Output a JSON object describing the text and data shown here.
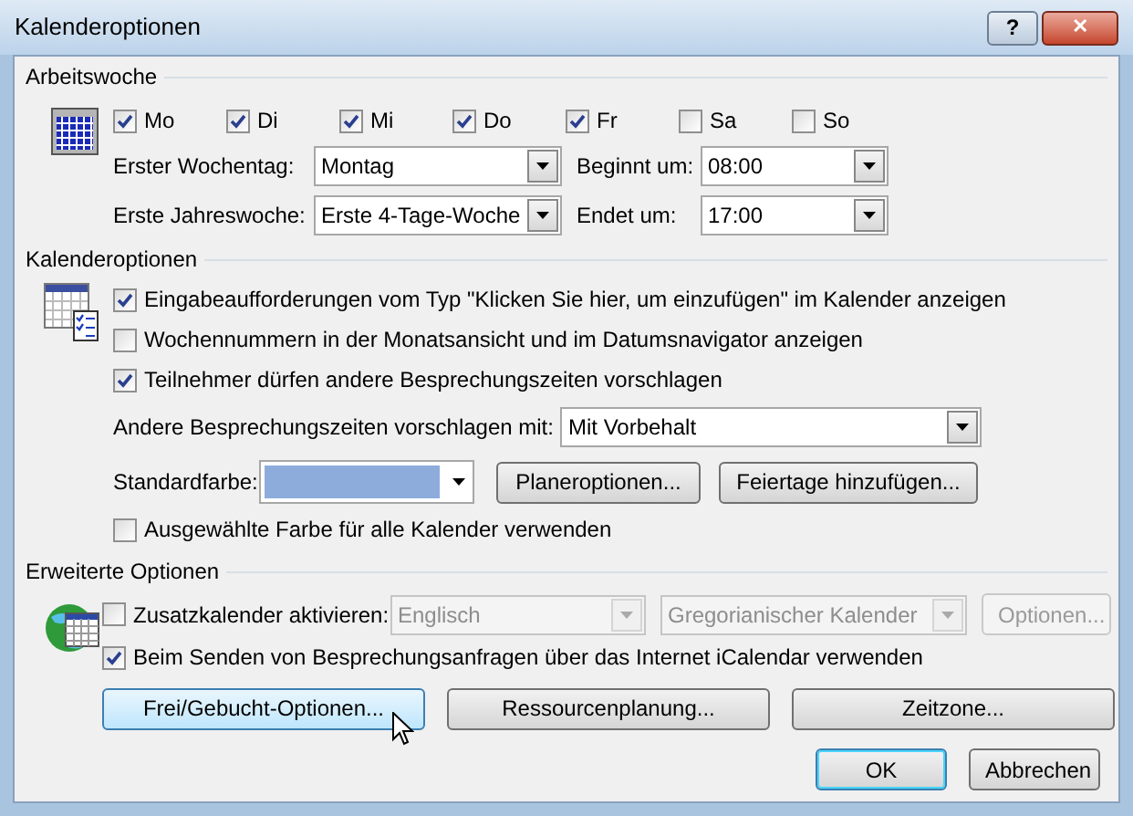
{
  "window": {
    "title": "Kalenderoptionen",
    "help_button": "?",
    "close_button": "✕"
  },
  "work_week": {
    "heading": "Arbeitswoche",
    "days": [
      {
        "label": "Mo",
        "checked": true
      },
      {
        "label": "Di",
        "checked": true
      },
      {
        "label": "Mi",
        "checked": true
      },
      {
        "label": "Do",
        "checked": true
      },
      {
        "label": "Fr",
        "checked": true
      },
      {
        "label": "Sa",
        "checked": false
      },
      {
        "label": "So",
        "checked": false
      }
    ],
    "first_day": {
      "label": "Erster Wochentag:",
      "value": "Montag"
    },
    "first_week": {
      "label": "Erste Jahreswoche:",
      "value": "Erste 4-Tage-Woche"
    },
    "start": {
      "label": "Beginnt um:",
      "value": "08:00"
    },
    "end": {
      "label": "Endet um:",
      "value": "17:00"
    }
  },
  "calendar_options": {
    "heading": "Kalenderoptionen",
    "checks": [
      {
        "label": "Eingabeaufforderungen vom Typ \"Klicken Sie hier, um einzufügen\" im Kalender anzeigen",
        "checked": true
      },
      {
        "label": "Wochennummern in der Monatsansicht und im Datumsnavigator anzeigen",
        "checked": false
      },
      {
        "label": "Teilnehmer dürfen andere Besprechungszeiten vorschlagen",
        "checked": true
      }
    ],
    "propose": {
      "label": "Andere Besprechungszeiten vorschlagen mit:",
      "value": "Mit Vorbehalt"
    },
    "default_color": {
      "label": "Standardfarbe:",
      "color": "#8eacdb"
    },
    "buttons": [
      {
        "label": "Planeroptionen..."
      },
      {
        "label": "Feiertage hinzufügen..."
      }
    ],
    "all_calendars": {
      "label": "Ausgewählte Farbe für alle Kalender verwenden",
      "checked": false
    }
  },
  "advanced": {
    "heading": "Erweiterte Optionen",
    "additional": {
      "label": "Zusatzkalender aktivieren:",
      "checked": false,
      "language": "Englisch",
      "calendar": "Gregorianischer Kalender",
      "options_button": "Optionen...",
      "disabled": true
    },
    "icalendar": {
      "label": "Beim Senden von Besprechungsanfragen über das Internet iCalendar verwenden",
      "checked": true
    },
    "buttons": [
      {
        "label": "Frei/Gebucht-Optionen...",
        "hovered": true
      },
      {
        "label": "Ressourcenplanung...",
        "hovered": false
      },
      {
        "label": "Zeitzone...",
        "hovered": false
      }
    ]
  },
  "footer": {
    "buttons": [
      {
        "label": "OK",
        "default": true
      },
      {
        "label": "Abbrechen",
        "default": false
      }
    ]
  }
}
